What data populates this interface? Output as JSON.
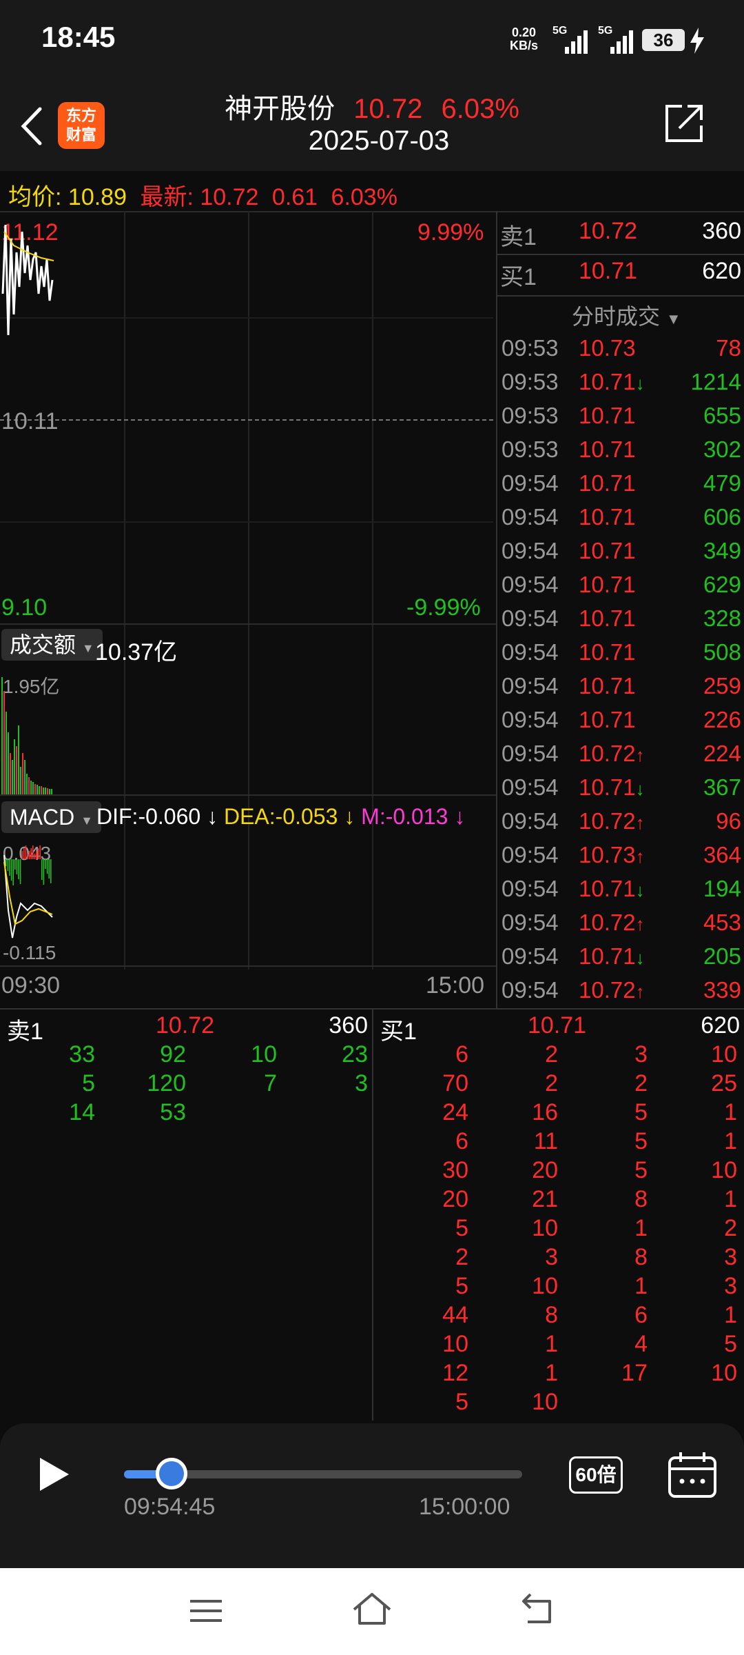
{
  "status": {
    "time": "18:45",
    "speed_value": "0.20",
    "speed_unit": "KB/s",
    "net1": "5G",
    "net2": "5G",
    "battery": "36"
  },
  "header": {
    "logo_line1": "东方",
    "logo_line2": "财富",
    "stock_name": "神开股份",
    "price": "10.72",
    "change_pct": "6.03%",
    "date": "2025-07-03"
  },
  "summary": {
    "avg_label": "均价:",
    "avg_value": "10.89",
    "latest_label": "最新:",
    "latest_value": "10.72",
    "change": "0.61",
    "change_pct": "6.03%"
  },
  "chart": {
    "price_high": "11.12",
    "pct_high": "9.99%",
    "price_mid": "10.11",
    "price_low": "9.10",
    "pct_low": "-9.99%",
    "turnover_selector": "成交额",
    "turnover_total": "10.37亿",
    "turnover_max": "1.95亿",
    "macd_selector": "MACD",
    "dif": "DIF:-0.060",
    "dea": "DEA:-0.053",
    "m": "M:-0.013",
    "macd_max": "0.043",
    "macd_min": "-0.115",
    "time_start": "09:30",
    "time_end": "15:00",
    "colors": {
      "up": "#ff2b2b",
      "down": "#20c020",
      "avg": "#f5d90a"
    }
  },
  "quote": {
    "ask_label": "卖1",
    "ask_price": "10.72",
    "ask_vol": "360",
    "bid_label": "买1",
    "bid_price": "10.71",
    "bid_vol": "620",
    "ticks_title": "分时成交"
  },
  "ticks": [
    {
      "time": "09:53",
      "price": "10.73",
      "arrow": "",
      "vol": "78",
      "side": "up"
    },
    {
      "time": "09:53",
      "price": "10.71",
      "arrow": "↓",
      "vol": "1214",
      "side": "down"
    },
    {
      "time": "09:53",
      "price": "10.71",
      "arrow": "",
      "vol": "655",
      "side": "down"
    },
    {
      "time": "09:53",
      "price": "10.71",
      "arrow": "",
      "vol": "302",
      "side": "down"
    },
    {
      "time": "09:54",
      "price": "10.71",
      "arrow": "",
      "vol": "479",
      "side": "down"
    },
    {
      "time": "09:54",
      "price": "10.71",
      "arrow": "",
      "vol": "606",
      "side": "down"
    },
    {
      "time": "09:54",
      "price": "10.71",
      "arrow": "",
      "vol": "349",
      "side": "down"
    },
    {
      "time": "09:54",
      "price": "10.71",
      "arrow": "",
      "vol": "629",
      "side": "down"
    },
    {
      "time": "09:54",
      "price": "10.71",
      "arrow": "",
      "vol": "328",
      "side": "down"
    },
    {
      "time": "09:54",
      "price": "10.71",
      "arrow": "",
      "vol": "508",
      "side": "down"
    },
    {
      "time": "09:54",
      "price": "10.71",
      "arrow": "",
      "vol": "259",
      "side": "up"
    },
    {
      "time": "09:54",
      "price": "10.71",
      "arrow": "",
      "vol": "226",
      "side": "up"
    },
    {
      "time": "09:54",
      "price": "10.72",
      "arrow": "↑",
      "vol": "224",
      "side": "up"
    },
    {
      "time": "09:54",
      "price": "10.71",
      "arrow": "↓",
      "vol": "367",
      "side": "down"
    },
    {
      "time": "09:54",
      "price": "10.72",
      "arrow": "↑",
      "vol": "96",
      "side": "up"
    },
    {
      "time": "09:54",
      "price": "10.73",
      "arrow": "↑",
      "vol": "364",
      "side": "up"
    },
    {
      "time": "09:54",
      "price": "10.71",
      "arrow": "↓",
      "vol": "194",
      "side": "down"
    },
    {
      "time": "09:54",
      "price": "10.72",
      "arrow": "↑",
      "vol": "453",
      "side": "up"
    },
    {
      "time": "09:54",
      "price": "10.71",
      "arrow": "↓",
      "vol": "205",
      "side": "down"
    },
    {
      "time": "09:54",
      "price": "10.72",
      "arrow": "↑",
      "vol": "339",
      "side": "up"
    }
  ],
  "ask_queue": [
    [
      "33",
      "92",
      "10",
      "23"
    ],
    [
      "5",
      "120",
      "7",
      "3"
    ],
    [
      "14",
      "53",
      "",
      ""
    ]
  ],
  "bid_queue": [
    [
      "6",
      "2",
      "3",
      "10"
    ],
    [
      "70",
      "2",
      "2",
      "25"
    ],
    [
      "24",
      "16",
      "5",
      "1"
    ],
    [
      "6",
      "11",
      "5",
      "1"
    ],
    [
      "30",
      "20",
      "5",
      "10"
    ],
    [
      "20",
      "21",
      "8",
      "1"
    ],
    [
      "5",
      "10",
      "1",
      "2"
    ],
    [
      "2",
      "3",
      "8",
      "3"
    ],
    [
      "5",
      "10",
      "1",
      "3"
    ],
    [
      "44",
      "8",
      "6",
      "1"
    ],
    [
      "10",
      "1",
      "4",
      "5"
    ],
    [
      "12",
      "1",
      "17",
      "10"
    ],
    [
      "5",
      "10",
      "",
      ""
    ]
  ],
  "playback": {
    "current_time": "09:54:45",
    "end_time": "15:00:00",
    "progress": 0.12,
    "speed": "60倍"
  }
}
